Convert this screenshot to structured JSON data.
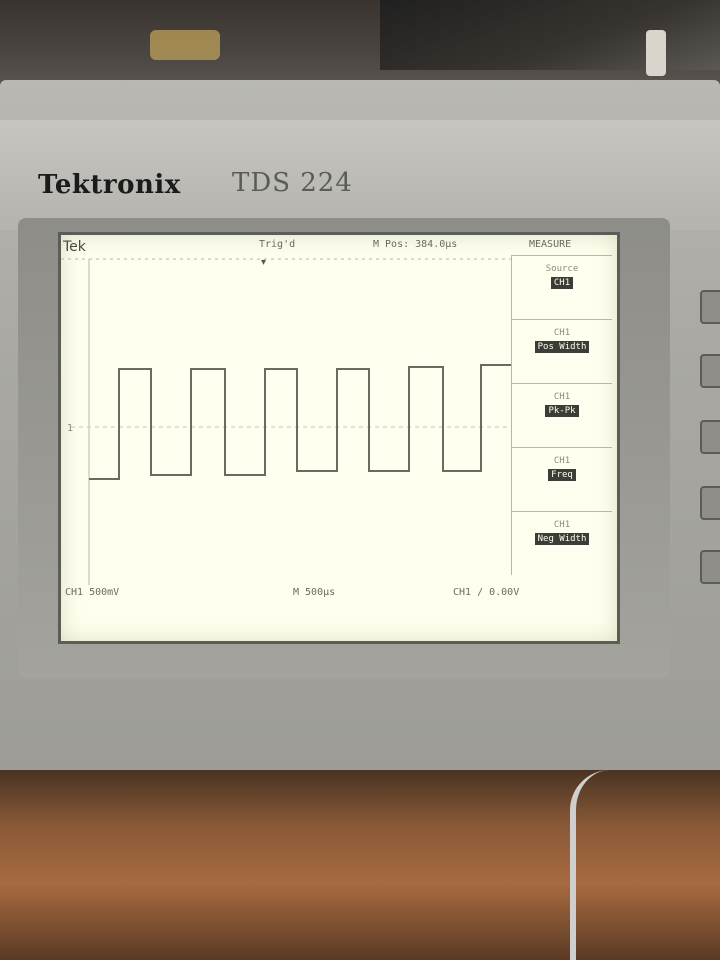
{
  "device": {
    "brand": "Tektronix",
    "model": "TDS 224"
  },
  "screen": {
    "top_bar": {
      "tek": "Tek",
      "trigger_status": "Trig'd",
      "position": "M Pos: 384.0µs",
      "menu_title": "MEASURE"
    },
    "bottom_bar": {
      "channel_scale": "CH1  500mV",
      "time_scale": "M 500µs",
      "trigger_level": "CH1 / 0.00V"
    },
    "side_menu": [
      {
        "label": "Source",
        "value": "CH1"
      },
      {
        "label": "CH1",
        "value": "Pos Width"
      },
      {
        "label": "CH1",
        "value": "Pk-Pk"
      },
      {
        "label": "CH1",
        "value": "Freq"
      },
      {
        "label": "CH1",
        "value": "Neg Width"
      }
    ]
  },
  "colors": {
    "screen_bg": "#fffff0",
    "trace": "#6a6a62",
    "graticule": "#b8b8a8"
  }
}
